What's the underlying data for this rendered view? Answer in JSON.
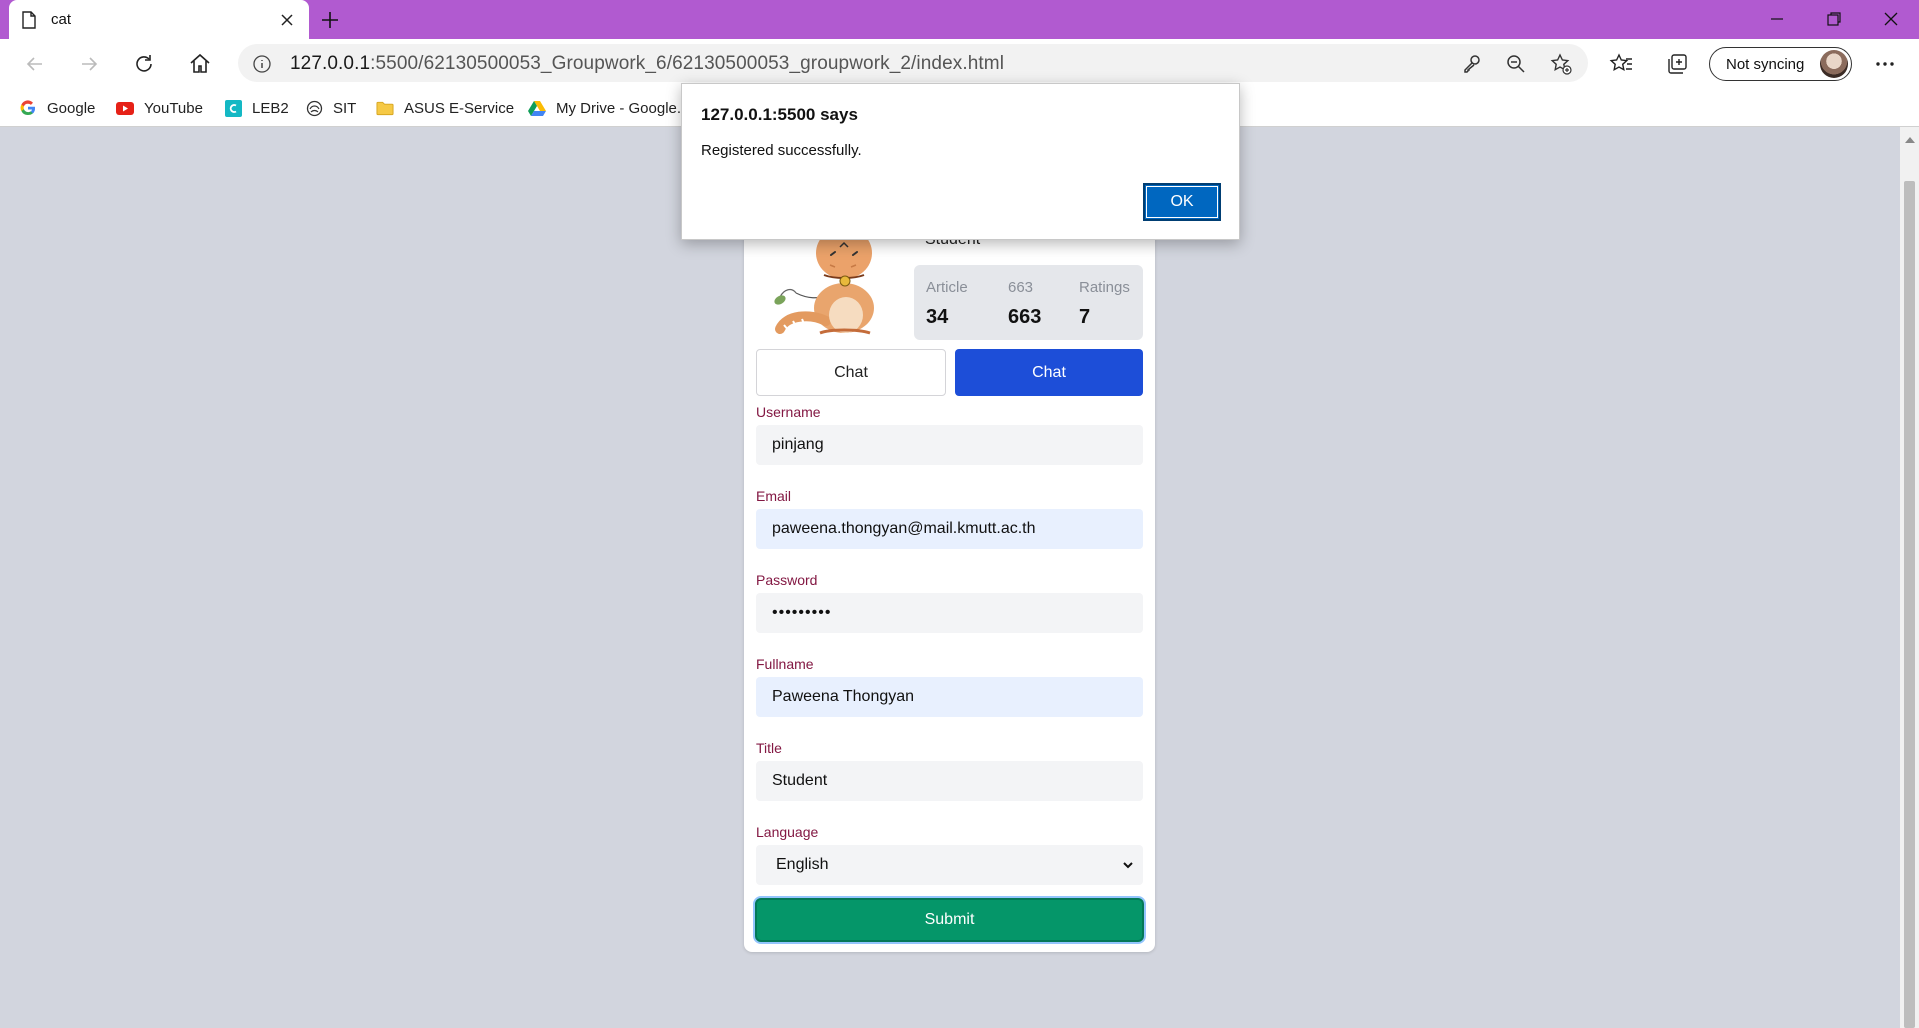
{
  "browser": {
    "tab_title": "cat",
    "url_host": "127.0.0.1",
    "url_rest": ":5500/62130500053_Groupwork_6/62130500053_groupwork_2/index.html",
    "sync_label": "Not syncing",
    "bookmarks": [
      {
        "label": "Google",
        "icon": "google-icon"
      },
      {
        "label": "YouTube",
        "icon": "youtube-icon"
      },
      {
        "label": "LEB2",
        "icon": "leb2-icon"
      },
      {
        "label": "SIT",
        "icon": "sit-icon"
      },
      {
        "label": "ASUS E-Service",
        "icon": "folder-icon"
      },
      {
        "label": "My Drive - Google...",
        "icon": "google-drive-icon"
      }
    ],
    "accent_color": "#b15ad0"
  },
  "dialog": {
    "title": "127.0.0.1:5500 says",
    "message": "Registered successfully.",
    "ok_label": "OK"
  },
  "profile": {
    "title": "Student",
    "stats": [
      {
        "label": "Article",
        "value": "34"
      },
      {
        "label": "663",
        "value": "663"
      },
      {
        "label": "Ratings",
        "value": "7"
      }
    ],
    "chat_button_1": "Chat",
    "chat_button_2": "Chat"
  },
  "form": {
    "username_label": "Username",
    "username_value": "pinjang",
    "email_label": "Email",
    "email_value": "paweena.thongyan@mail.kmutt.ac.th",
    "password_label": "Password",
    "password_value": "•••••••••",
    "fullname_label": "Fullname",
    "fullname_value": "Paweena Thongyan",
    "title_label": "Title",
    "title_value": "Student",
    "language_label": "Language",
    "language_value": "English",
    "submit_label": "Submit"
  }
}
